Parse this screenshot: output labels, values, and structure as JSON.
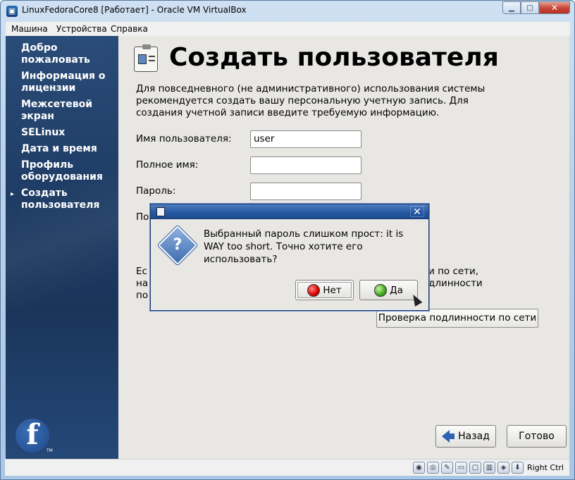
{
  "window": {
    "title": "LinuxFedoraCore8 [Работает] - Oracle VM VirtualBox",
    "minimize_glyph": "▁",
    "maximize_glyph": "□",
    "close_glyph": "✕"
  },
  "menubar": {
    "items": [
      {
        "label": "Машина"
      },
      {
        "label": "Устройства"
      },
      {
        "label": "Справка"
      }
    ]
  },
  "sidebar": {
    "current_marker": "▸",
    "steps": [
      {
        "line1": "Добро",
        "line2": "пожаловать"
      },
      {
        "line1": "Информация о",
        "line2": "лицензии"
      },
      {
        "line1": "Межсетевой",
        "line2": "экран"
      },
      {
        "line1": "SELinux",
        "line2": ""
      },
      {
        "line1": "Дата и время",
        "line2": ""
      },
      {
        "line1": "Профиль",
        "line2": "оборудования"
      },
      {
        "line1": "Создать",
        "line2": "пользователя"
      }
    ],
    "logo_glyph": "f",
    "logo_tm": "TM"
  },
  "page": {
    "title": "Создать пользователя",
    "description": "Для повседневного (не административного) использования системы рекомендуется создать вашу персональную учетную запись. Для создания учетной записи введите требуемую информацию.",
    "fields": [
      {
        "label": "Имя пользователя:",
        "value": "user"
      },
      {
        "label": "Полное имя:",
        "value": ""
      },
      {
        "label": "Пароль:",
        "value": ""
      },
      {
        "label": "По",
        "value": ""
      }
    ],
    "auth_left_lines": [
      "Ес",
      "на",
      "по"
    ],
    "auth_right_lines": [
      "и по сети,",
      "длинности"
    ],
    "auth_button": "Проверка подлинности по сети",
    "back_button": "Назад",
    "finish_button": "Готово"
  },
  "dialog": {
    "close_glyph": "✕",
    "question_glyph": "?",
    "message": "Выбранный пароль слишком прост: it is WAY too short. Точно хотите его использовать?",
    "no_button": "Нет",
    "yes_button": "Да"
  },
  "statusbar": {
    "icons": [
      "hdd-icon",
      "cd-icon",
      "usb-icon",
      "shared-folder-icon",
      "folder-icon",
      "display-icon",
      "network-icon",
      "mouse-integration-icon"
    ],
    "host_key": "Right Ctrl"
  }
}
